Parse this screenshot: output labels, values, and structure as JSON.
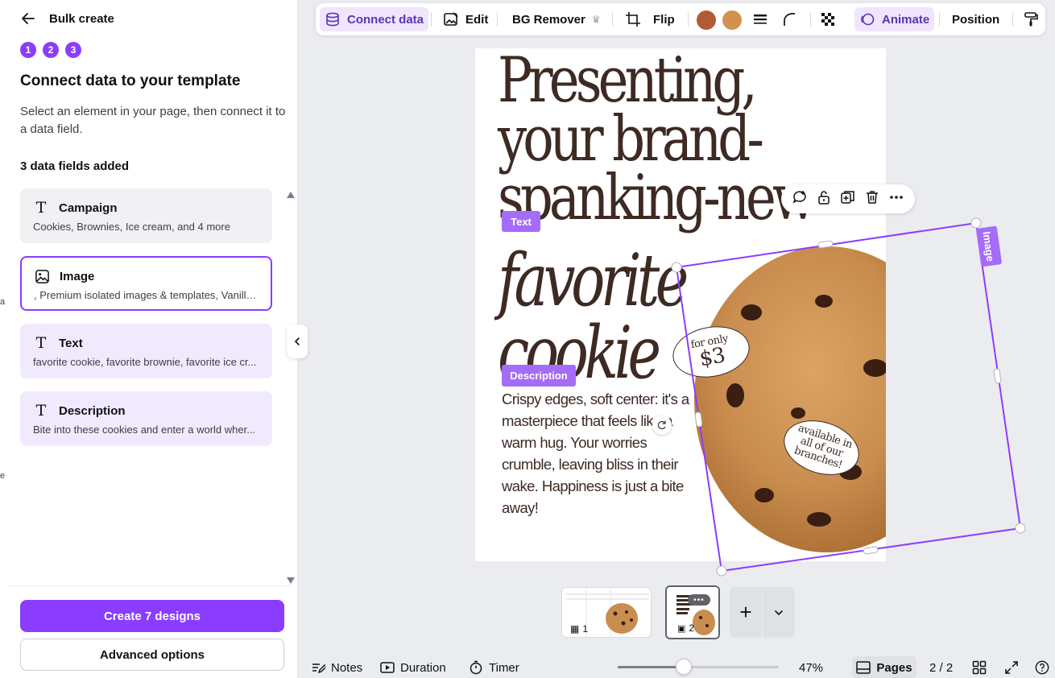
{
  "panel": {
    "back_title": "Bulk create",
    "steps": [
      "1",
      "2",
      "3"
    ],
    "heading": "Connect data to your template",
    "description": "Select an element in your page, then connect it to a data field.",
    "fields_count": "3 data fields added",
    "edge_chars": [
      "a",
      "e"
    ],
    "fields": [
      {
        "icon": "text-icon",
        "name": "Campaign",
        "values": "Cookies, Brownies, Ice cream, and 4 more"
      },
      {
        "icon": "image-icon",
        "name": "Image",
        "values": ", Premium isolated images & templates, Vanilla ..."
      },
      {
        "icon": "text-icon",
        "name": "Text",
        "values": "favorite cookie, favorite brownie, favorite ice cr..."
      },
      {
        "icon": "text-icon",
        "name": "Description",
        "values": "Bite into these cookies and enter a world wher..."
      }
    ],
    "create_button": "Create 7 designs",
    "advanced_button": "Advanced options"
  },
  "toolbar": {
    "connect_data": "Connect data",
    "edit": "Edit",
    "bg_remover": "BG Remover",
    "flip": "Flip",
    "animate": "Animate",
    "position": "Position",
    "colors": [
      "#b35a37",
      "#d4914e"
    ]
  },
  "canvas": {
    "headline_lines": [
      "Presenting,",
      "your brand-",
      "spanking-new"
    ],
    "fav_lines": [
      "favorite",
      "cookie"
    ],
    "description": "Crispy edges, soft center: it's a masterpiece that feels like a warm hug. Your worries crumble, leaving bliss in their wake. Happiness is just a bite away!",
    "bubble1_small": "for only",
    "bubble1_big": "$3",
    "bubble2": "available in all of our branches!",
    "tag_text": "Text",
    "tag_description": "Description",
    "tag_image": "Image",
    "context_menu": [
      "comment-add-icon",
      "lock-icon",
      "duplicate-icon",
      "trash-icon",
      "more-icon"
    ]
  },
  "thumbnails": [
    {
      "number": "1"
    },
    {
      "number": "2"
    }
  ],
  "bottom": {
    "notes": "Notes",
    "duration": "Duration",
    "timer": "Timer",
    "zoom": "47%",
    "zoom_fraction": 0.41,
    "pages": "Pages",
    "page_count": "2 / 2"
  },
  "colors": {
    "accent": "#8b3dff",
    "tag": "#a46cf9",
    "ink": "#3d2a22"
  }
}
